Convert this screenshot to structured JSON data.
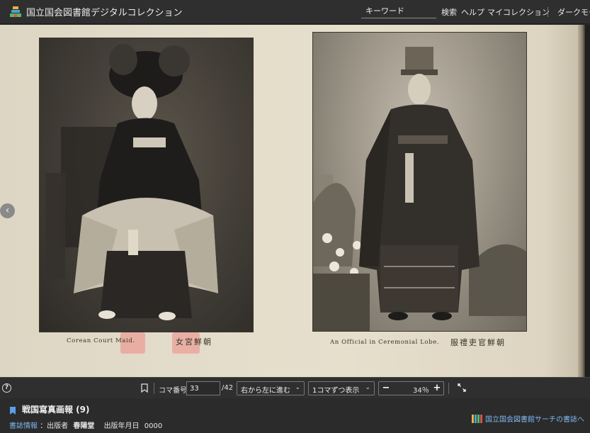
{
  "header": {
    "site_title": "国立国会図書館デジタルコレクション",
    "search_placeholder": "キーワード",
    "search_button": "検索",
    "help": "ヘルプ",
    "my_collection": "マイコレクション",
    "dark_mode": "ダークモー"
  },
  "page": {
    "left_caption": "Corean Court Maid.",
    "left_caption_jp": "朝鮮宮女",
    "right_caption": "An Official in Ceremonial Lobe.",
    "right_caption_jp": "朝鮮官吏禮服"
  },
  "navigation": {
    "prev_icon": "chevron-left-icon",
    "prev_glyph": "‹"
  },
  "toolbar": {
    "help_glyph": "?",
    "frame_label": "コマ番号",
    "frame_value": "33",
    "frame_total": "/42",
    "direction_select": "右から左に進む",
    "display_select": "1コマずつ表示",
    "zoom_minus": "−",
    "zoom_value": "34％",
    "zoom_plus": "+",
    "caret": "⌄"
  },
  "footer": {
    "title": "戦国寫真画報 (9)",
    "biblio_link": "書誌情報",
    "publisher_label": "：出版者",
    "publisher": "春陽堂",
    "date_label": "出版年月日",
    "date": "0000",
    "ndl_search_link": "国立国会図書館サーチの書誌へ"
  },
  "colors": {
    "accent_link": "#7fb6ee",
    "bar_bg": "#2f2f2f",
    "highlight": "#f07878"
  }
}
